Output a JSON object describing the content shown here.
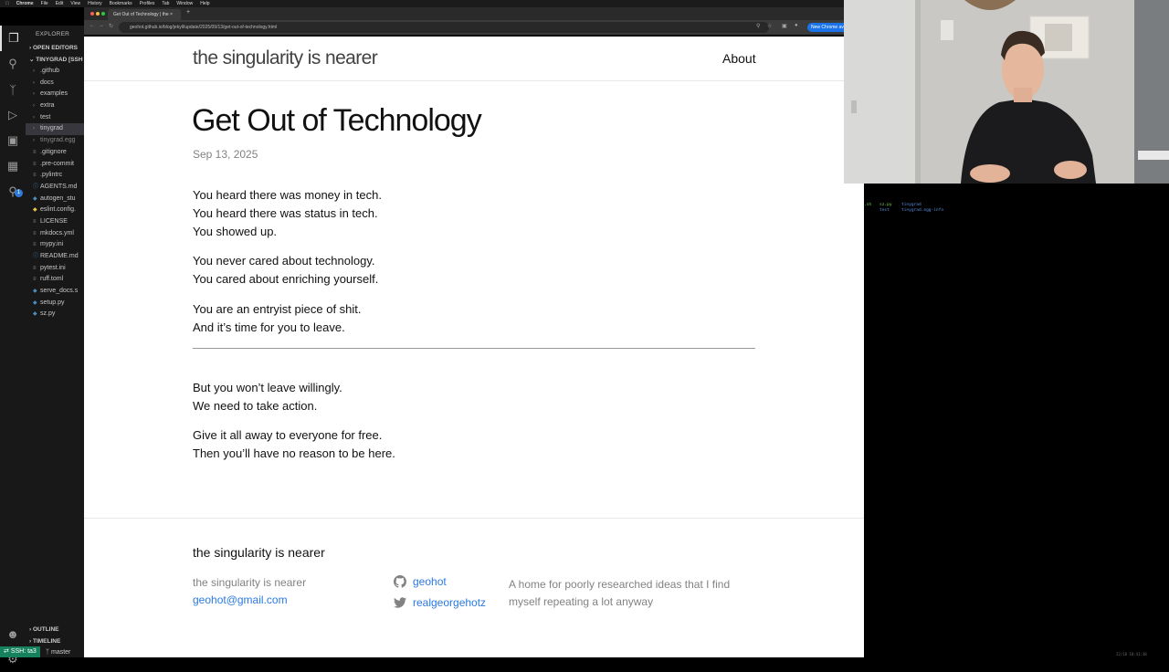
{
  "menubar": {
    "items": [
      "Chrome",
      "File",
      "Edit",
      "View",
      "History",
      "Bookmarks",
      "Profiles",
      "Tab",
      "Window",
      "Help"
    ]
  },
  "vscode": {
    "explorer_label": "EXPLORER",
    "open_editors": "OPEN EDITORS",
    "root": "TINYGRAD [SSH",
    "tree": [
      {
        "name": ".github",
        "kind": "folder"
      },
      {
        "name": "docs",
        "kind": "folder"
      },
      {
        "name": "examples",
        "kind": "folder"
      },
      {
        "name": "extra",
        "kind": "folder"
      },
      {
        "name": "test",
        "kind": "folder"
      },
      {
        "name": "tinygrad",
        "kind": "folder",
        "selected": true
      },
      {
        "name": "tinygrad.egg",
        "kind": "folder",
        "dim": true
      },
      {
        "name": ".gitignore",
        "kind": "file"
      },
      {
        "name": ".pre-commit",
        "kind": "file"
      },
      {
        "name": ".pylintrc",
        "kind": "file"
      },
      {
        "name": "AGENTS.md",
        "kind": "md"
      },
      {
        "name": "autogen_stu",
        "kind": "py"
      },
      {
        "name": "eslint.config.",
        "kind": "js"
      },
      {
        "name": "LICENSE",
        "kind": "file"
      },
      {
        "name": "mkdocs.yml",
        "kind": "file"
      },
      {
        "name": "mypy.ini",
        "kind": "file"
      },
      {
        "name": "README.md",
        "kind": "md"
      },
      {
        "name": "pytest.ini",
        "kind": "file"
      },
      {
        "name": "ruff.toml",
        "kind": "file"
      },
      {
        "name": "serve_docs.s",
        "kind": "py"
      },
      {
        "name": "setup.py",
        "kind": "py"
      },
      {
        "name": "sz.py",
        "kind": "py"
      }
    ],
    "outline": "OUTLINE",
    "timeline": "TIMELINE",
    "remote": "SSH: ta3",
    "branch": "master",
    "badge": "1"
  },
  "browser": {
    "tab_title": "Get Out of Technology | the",
    "url": "geohot.github.io/blog/jekyll/update/2025/09/13/get-out-of-technology.html",
    "update_label": "New Chrome ava"
  },
  "site": {
    "title": "the singularity is nearer",
    "nav_about": "About",
    "post_title": "Get Out of Technology",
    "post_date": "Sep 13, 2025",
    "paragraphs": [
      [
        "You heard there was money in tech.",
        "You heard there was status in tech.",
        "You showed up."
      ],
      [
        "You never cared about technology.",
        "You cared about enriching yourself."
      ],
      [
        "You are an entryist piece of shit.",
        "And it’s time for you to leave."
      ],
      [
        "But you won’t leave willingly.",
        "We need to take action."
      ],
      [
        "Give it all away to everyone for free.",
        "Then you’ll have no reason to be here."
      ]
    ],
    "footer": {
      "heading": "the singularity is nearer",
      "name": "the singularity is nearer",
      "email": "geohot@gmail.com",
      "github": "geohot",
      "twitter": "realgeorgehotz",
      "description": "A home for poorly researched ideas that I find myself repeating a lot anyway"
    }
  },
  "terminal": {
    "line1_a": ".sh",
    "line1_b": "sz.py",
    "line1_c": "tinygrad",
    "line2_b": "test",
    "line2_c": "tinygrad.egg-info",
    "status": "22/18  10:41:38"
  },
  "colors": {
    "link": "#2a7ae2",
    "muted": "#828282",
    "vscode_bg": "#181818",
    "remote_green": "#16825d",
    "terminal_green": "#7fd35e",
    "terminal_blue": "#5b8fe0"
  }
}
